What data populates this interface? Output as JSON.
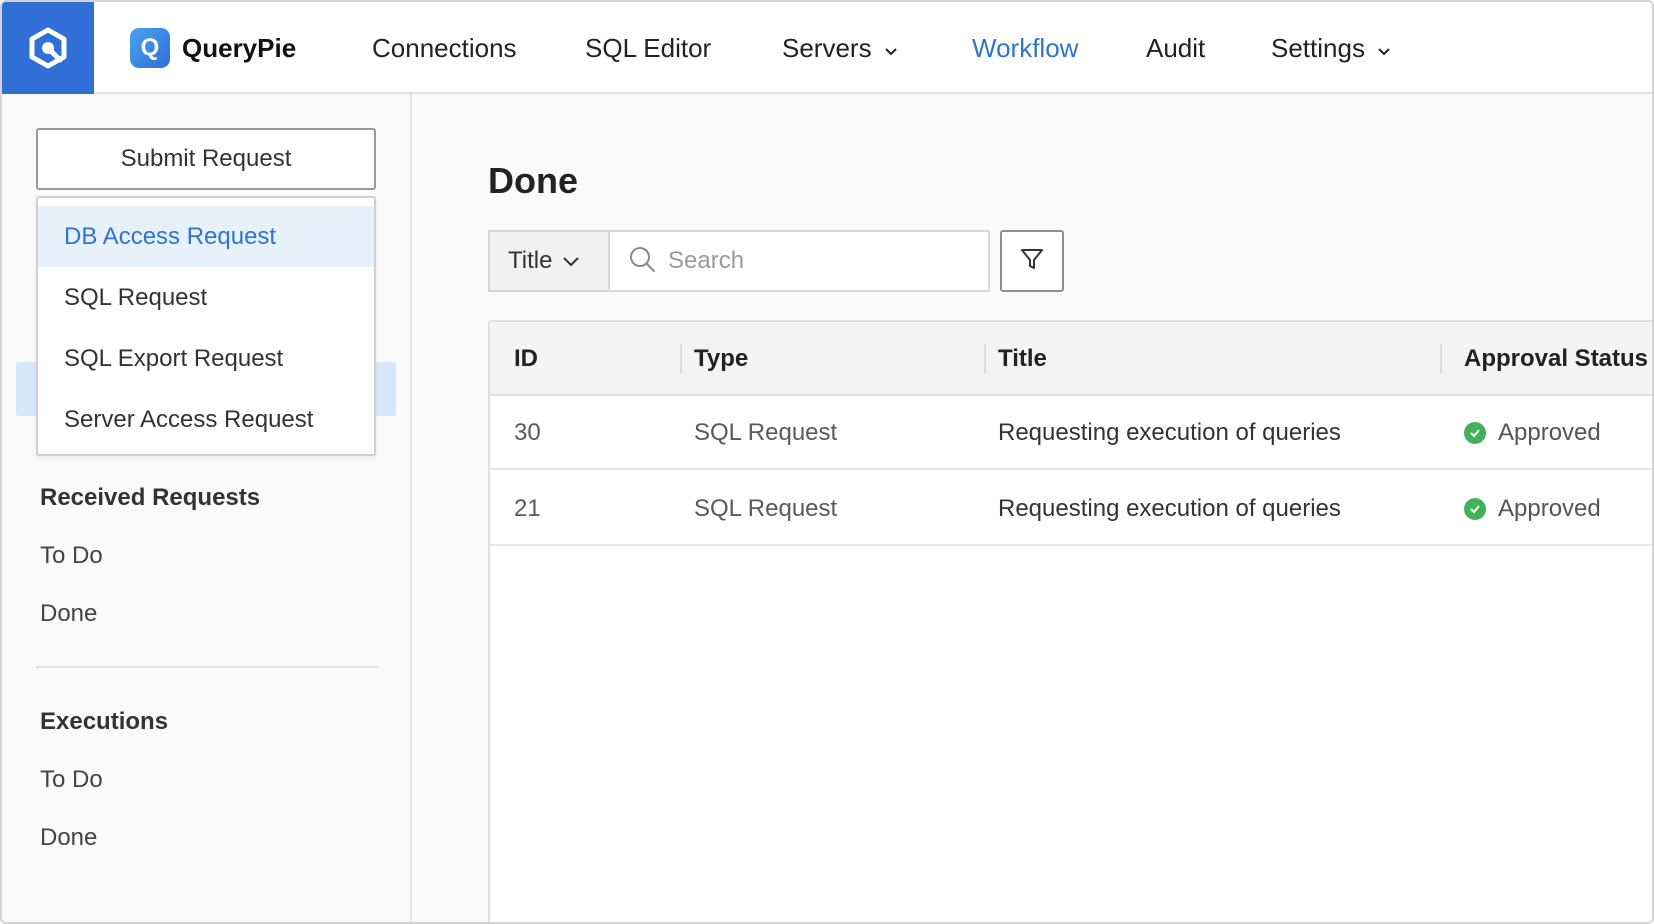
{
  "app": {
    "brand_letter": "Q",
    "brand_name": "QueryPie",
    "accent_color": "#2f74d0",
    "logo_bg_color": "#2f6fd6"
  },
  "nav": {
    "items": [
      {
        "label": "Connections",
        "icon": null,
        "active": false
      },
      {
        "label": "SQL Editor",
        "icon": null,
        "active": false
      },
      {
        "label": "Servers",
        "icon": "chevron-down-icon",
        "active": false
      },
      {
        "label": "Workflow",
        "icon": null,
        "active": true
      },
      {
        "label": "Audit",
        "icon": null,
        "active": false
      },
      {
        "label": "Settings",
        "icon": "chevron-down-icon",
        "active": false
      }
    ]
  },
  "sidebar": {
    "submit_label": "Submit Request",
    "dropdown": [
      {
        "label": "DB Access Request",
        "highlighted": true
      },
      {
        "label": "SQL Request",
        "highlighted": false
      },
      {
        "label": "SQL Export Request",
        "highlighted": false
      },
      {
        "label": "Server Access Request",
        "highlighted": false
      }
    ],
    "received": {
      "heading": "Received Requests",
      "links": [
        "To Do",
        "Done"
      ]
    },
    "executions": {
      "heading": "Executions",
      "links": [
        "To Do",
        "Done"
      ]
    }
  },
  "main": {
    "title": "Done",
    "search": {
      "field_select": "Title",
      "placeholder": "Search",
      "value": ""
    },
    "table": {
      "columns": [
        "ID",
        "Type",
        "Title",
        "Approval Status"
      ],
      "rows": [
        {
          "id": "30",
          "type": "SQL Request",
          "title": "Requesting execution of queries",
          "status": "Approved"
        },
        {
          "id": "21",
          "type": "SQL Request",
          "title": "Requesting execution of queries",
          "status": "Approved"
        }
      ]
    },
    "status_color": "#43b05c"
  }
}
